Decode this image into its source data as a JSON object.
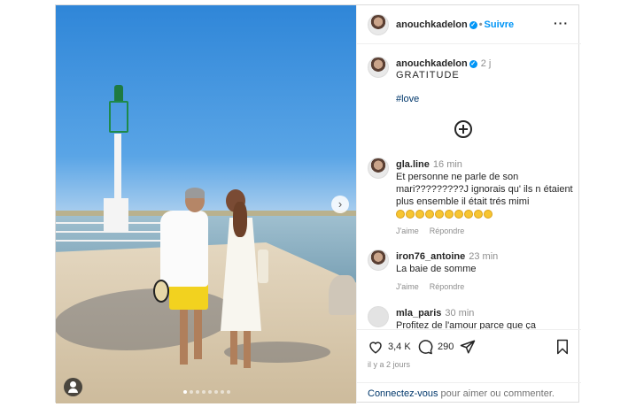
{
  "post": {
    "username": "anouchkadelon",
    "follow_label": "Suivre",
    "separator": "•",
    "caption_time": "2 j",
    "caption_text": "GRATITUDE",
    "hashtag": "#love",
    "image_dots": 8,
    "image_active_dot": 1
  },
  "comments": [
    {
      "user": "gla.line",
      "time": "16 min",
      "text": "Et personne ne parle de son mari?????????J ignorais qu' ils n étaient plus ensemble il était trés mimi",
      "emoji_count": 10,
      "like": "J'aime",
      "reply": "Répondre"
    },
    {
      "user": "iron76_antoine",
      "time": "23 min",
      "text": "La baie de somme",
      "like": "J'aime",
      "reply": "Répondre"
    },
    {
      "user": "mla_paris",
      "time": "30 min",
      "text": "Profitez de l'amour parce que ça"
    }
  ],
  "stats": {
    "likes": "3,4 K",
    "comments": "290",
    "posted_ago": "il y a 2 jours"
  },
  "footer": {
    "login_link": "Connectez-vous",
    "login_rest": " pour aimer ou commenter."
  },
  "icons": {
    "verified": "verified-badge-icon",
    "more": "more-options-icon",
    "load_more": "plus-circle-icon",
    "like": "heart-icon",
    "comment": "comment-bubble-icon",
    "share": "paper-plane-icon",
    "save": "bookmark-icon",
    "next": "chevron-right-icon",
    "tag": "user-tag-icon"
  },
  "colors": {
    "accent": "#0095f6",
    "link": "#00376b",
    "muted": "#8e8e8e"
  }
}
